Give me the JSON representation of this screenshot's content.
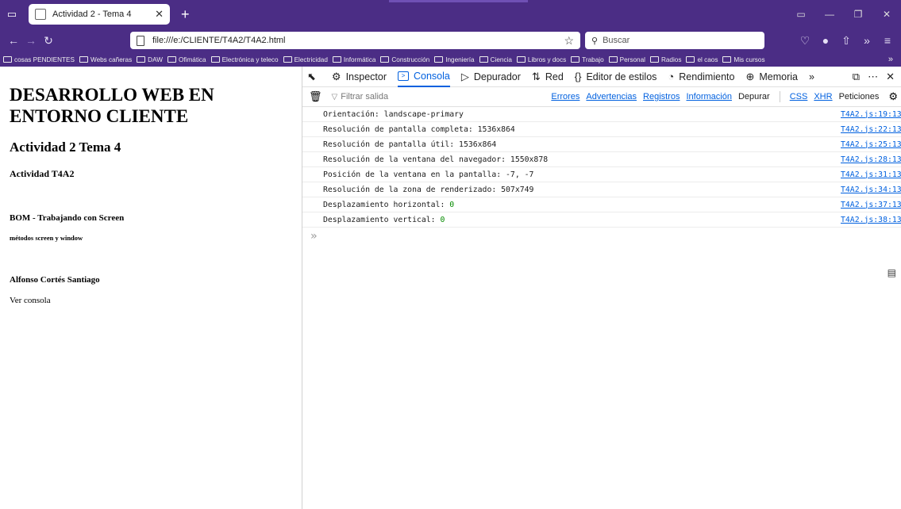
{
  "browser": {
    "tab_title": "Actividad 2 - Tema 4",
    "url": "file:///e:/CLIENTE/T4A2/T4A2.html",
    "search_placeholder": "Buscar"
  },
  "bookmarks": [
    "cosas PENDIENTES",
    "Webs cañeras",
    "DAW",
    "Ofimática",
    "Electrónica y teleco",
    "Electricidad",
    "Informática",
    "Construcción",
    "Ingeniería",
    "Ciencia",
    "Libros y docs",
    "Trabajo",
    "Personal",
    "Radios",
    "el caos",
    "Mis cursos"
  ],
  "page": {
    "h1": "DESARROLLO WEB EN ENTORNO CLIENTE",
    "h2": "Actividad 2 Tema 4",
    "h3": "Actividad T4A2",
    "h4": "BOM - Trabajando con Screen",
    "h5": "métodos screen y window",
    "author": "Alfonso Cortés Santiago",
    "see_console": "Ver consola"
  },
  "devtools": {
    "tabs": [
      "Inspector",
      "Consola",
      "Depurador",
      "Red",
      "Editor de estilos",
      "Rendimiento",
      "Memoria"
    ],
    "filter_placeholder": "Filtrar salida",
    "filters": [
      "Errores",
      "Advertencias",
      "Registros",
      "Información",
      "Depurar",
      "CSS",
      "XHR",
      "Peticiones"
    ],
    "logs": [
      {
        "text": "Orientación: landscape-primary",
        "num": "",
        "src": "T4A2.js:19:13"
      },
      {
        "text": "Resolución de pantalla completa: 1536x864",
        "num": "",
        "src": "T4A2.js:22:13"
      },
      {
        "text": "Resolución de pantalla útil: 1536x864",
        "num": "",
        "src": "T4A2.js:25:13"
      },
      {
        "text": "Resolución de la ventana del navegador: 1550x878",
        "num": "",
        "src": "T4A2.js:28:13"
      },
      {
        "text": "Posición de la ventana en la pantalla: -7, -7",
        "num": "",
        "src": "T4A2.js:31:13"
      },
      {
        "text": "Resolución de la zona de renderizado: 507x749",
        "num": "",
        "src": "T4A2.js:34:13"
      },
      {
        "text": "Desplazamiento horizontal: ",
        "num": "0",
        "src": "T4A2.js:37:13"
      },
      {
        "text": "Desplazamiento vertical: ",
        "num": "0",
        "src": "T4A2.js:38:13"
      }
    ]
  },
  "colors": {
    "chrome": "#4b2d85",
    "accent": "#0060df",
    "number": "#058b00"
  }
}
